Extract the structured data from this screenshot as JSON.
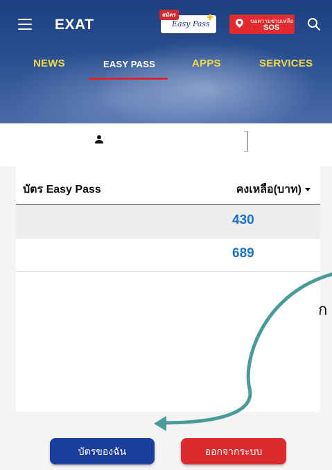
{
  "header": {
    "brand": "EXAT",
    "easypass_logo": {
      "badge": "สมัคร",
      "text": "Easy Pass"
    },
    "sos": {
      "sub_label": "ขอความช่วยเหลือ",
      "label": "SOS"
    }
  },
  "nav": {
    "items": [
      {
        "label": "NEWS",
        "active": false
      },
      {
        "label": "EASY PASS",
        "active": true
      },
      {
        "label": "APPS",
        "active": false
      },
      {
        "label": "SERVICES",
        "active": false
      }
    ]
  },
  "table": {
    "col_card": "บัตร Easy Pass",
    "col_balance": "คงเหลือ(บาท)",
    "rows": [
      {
        "card": "",
        "balance": "430"
      },
      {
        "card": "",
        "balance": "689"
      }
    ]
  },
  "buttons": {
    "my_cards": "บัตรของฉัน",
    "logout": "ออกจากระบบ"
  },
  "overlay": {
    "edge_char": "ก"
  },
  "colors": {
    "header_blue": "#1d3f80",
    "nav_yellow": "#f3d94a",
    "accent_red": "#d7262c",
    "balance_blue": "#1c72c9",
    "arrow_teal": "#4a9a9a"
  },
  "icons": [
    "menu-icon",
    "location-pin-icon",
    "search-icon",
    "person-icon",
    "sort-caret-icon"
  ]
}
